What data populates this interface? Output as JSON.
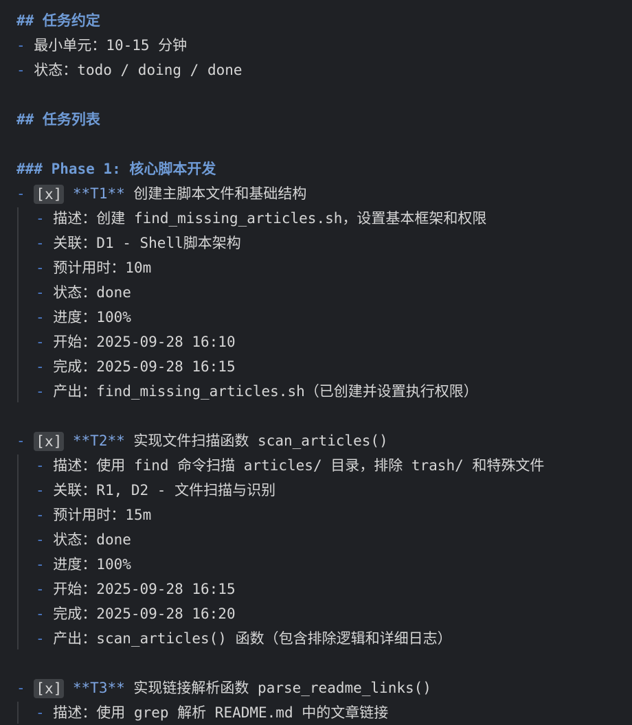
{
  "heading_task_rules": "## 任务约定",
  "rules": [
    "最小单元：10-15 分钟",
    "状态：todo / doing / done"
  ],
  "heading_task_list": "## 任务列表",
  "heading_phase1": "### Phase 1: 核心脚本开发",
  "tasks": [
    {
      "checkbox": "[x]",
      "id": "**T1**",
      "title": "创建主脚本文件和基础结构",
      "items": [
        "描述：创建 find_missing_articles.sh，设置基本框架和权限",
        "关联：D1 - Shell脚本架构",
        "预计用时：10m",
        "状态：done",
        "进度：100%",
        "开始：2025-09-28 16:10",
        "完成：2025-09-28 16:15",
        "产出：find_missing_articles.sh（已创建并设置执行权限）"
      ]
    },
    {
      "checkbox": "[x]",
      "id": "**T2**",
      "title": "实现文件扫描函数 scan_articles()",
      "items": [
        "描述：使用 find 命令扫描 articles/ 目录，排除 trash/ 和特殊文件",
        "关联：R1, D2 - 文件扫描与识别",
        "预计用时：15m",
        "状态：done",
        "进度：100%",
        "开始：2025-09-28 16:15",
        "完成：2025-09-28 16:20",
        "产出：scan_articles() 函数（包含排除逻辑和详细日志）"
      ]
    },
    {
      "checkbox": "[x]",
      "id": "**T3**",
      "title": "实现链接解析函数 parse_readme_links()",
      "items": [
        "描述：使用 grep 解析 README.md 中的文章链接"
      ]
    }
  ],
  "colors": {
    "background": "#1f2125",
    "text": "#d6d6d6",
    "heading": "#6f9bd6",
    "list_marker": "#4e7fd1",
    "bold_marker": "#7ea6e3",
    "checkbox_bg": "#3f4246"
  }
}
